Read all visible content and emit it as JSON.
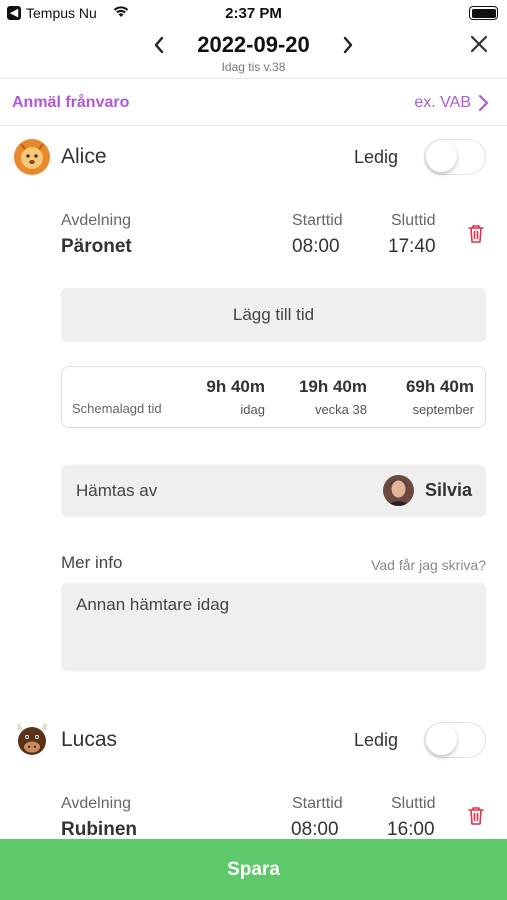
{
  "status_bar": {
    "back_app": "Tempus Nu",
    "time": "2:37 PM"
  },
  "header": {
    "date": "2022-09-20",
    "subtitle": "Idag tis v.38"
  },
  "absence": {
    "link": "Anmäl frånvaro",
    "hint": "ex. VAB"
  },
  "children": [
    {
      "name": "Alice",
      "avatar": "lion-avatar",
      "off_label": "Ledig",
      "off": false,
      "columns": {
        "department_label": "Avdelning",
        "department": "Päronet",
        "start_label": "Starttid",
        "start": "08:00",
        "end_label": "Sluttid",
        "end": "17:40"
      },
      "add_time_label": "Lägg till tid",
      "schedule": {
        "label": "Schemalagd tid",
        "items": [
          {
            "value": "9h 40m",
            "period": "idag"
          },
          {
            "value": "19h 40m",
            "period": "vecka 38"
          },
          {
            "value": "69h 40m",
            "period": "september"
          }
        ]
      },
      "pickup": {
        "label": "Hämtas av",
        "person": "Silvia"
      },
      "more_info": {
        "label": "Mer info",
        "hint": "Vad får jag skriva?",
        "text": "Annan hämtare idag"
      }
    },
    {
      "name": "Lucas",
      "avatar": "bull-avatar",
      "off_label": "Ledig",
      "off": false,
      "columns": {
        "department_label": "Avdelning",
        "department": "Rubinen",
        "start_label": "Starttid",
        "start": "08:00",
        "end_label": "Sluttid",
        "end": "16:00"
      }
    }
  ],
  "save_label": "Spara",
  "colors": {
    "accent": "#b05ad0",
    "save": "#5fc86a",
    "trash": "#e0304a"
  }
}
